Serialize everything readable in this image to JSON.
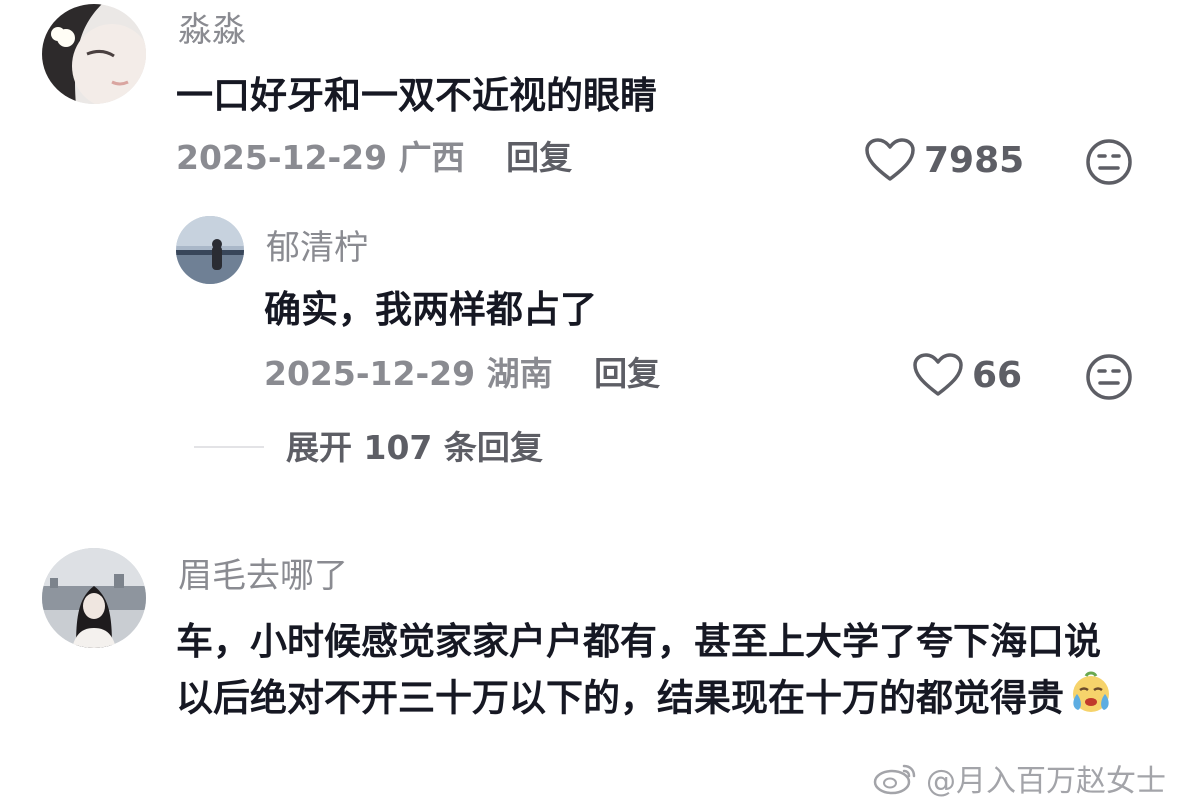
{
  "comments": [
    {
      "username": "淼淼",
      "text": "一口好牙和一双不近视的眼睛",
      "date": "2025-12-29",
      "location": "广西",
      "reply_label": "回复",
      "likes": "7985",
      "replies": [
        {
          "username": "郁清柠",
          "text": "确实，我两样都占了",
          "date": "2025-12-29",
          "location": "湖南",
          "reply_label": "回复",
          "likes": "66"
        }
      ],
      "expand_label": "展开 107 条回复"
    },
    {
      "username": "眉毛去哪了",
      "text": "车，小时候感觉家家户户都有，甚至上大学了夸下海口说以后绝对不开三十万以下的，结果现在十万的都觉得贵",
      "emoji": "crying-face-emoji"
    }
  ],
  "watermark": {
    "text": "@月入百万赵女士",
    "icon": "weibo-logo-icon"
  },
  "colors": {
    "primary_text": "#161823",
    "secondary_text": "#8a8b91",
    "icon": "#5d5e65"
  }
}
